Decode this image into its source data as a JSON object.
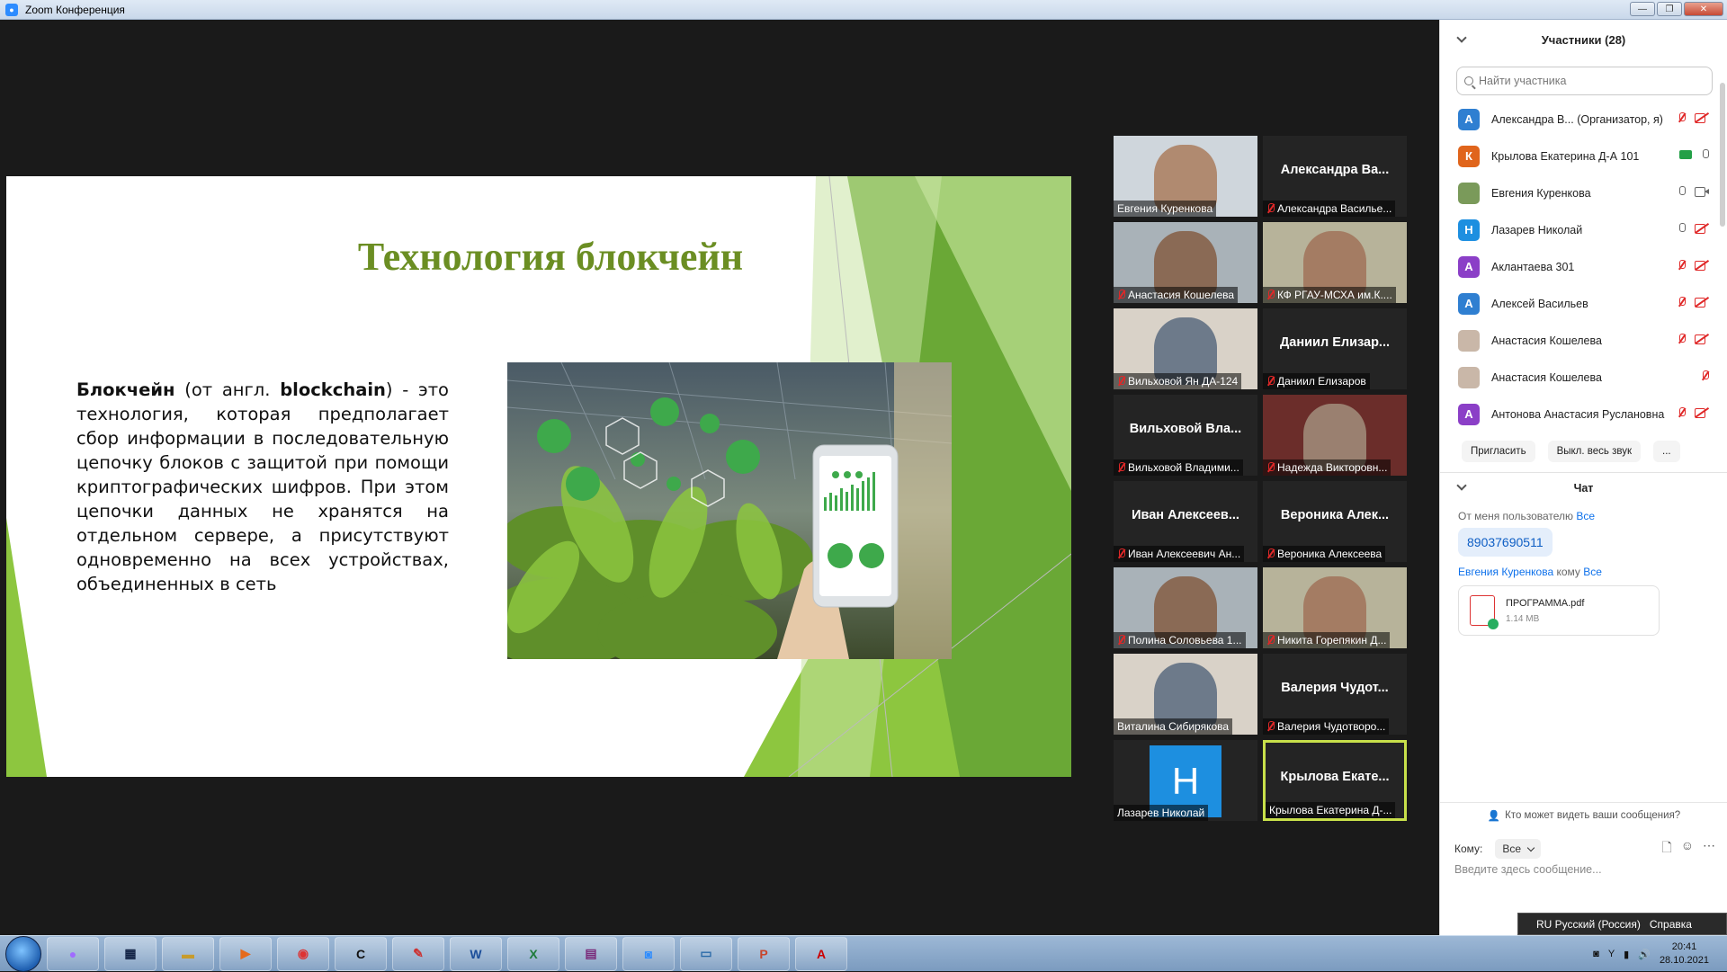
{
  "window": {
    "title": "Zoom Конференция"
  },
  "slide": {
    "title": "Технология блокчейн",
    "term": "Блокчейн",
    "intro": " (от англ. ",
    "english": "blockchain",
    "body": ") - это технология, которая предполагает сбор информации в последовательную цепочку блоков с защитой при помощи криптографических шифров. При этом цепочки данных не хранятся на отдельном сервере, а присутствуют одновременно на всех устройствах, объединенных в сеть"
  },
  "video_tiles": [
    {
      "caption": "Евгения Куренкова",
      "big_name": "",
      "muted": false,
      "video": true
    },
    {
      "caption": "Александра Василье...",
      "big_name": "Александра Ва...",
      "muted": true,
      "video": false
    },
    {
      "caption": "Анастасия Кошелева",
      "big_name": "",
      "muted": true,
      "video": true
    },
    {
      "caption": "КФ РГАУ-МСХА им.К....",
      "big_name": "",
      "muted": true,
      "video": true
    },
    {
      "caption": "Вильховой Ян ДА-124",
      "big_name": "",
      "muted": true,
      "video": true
    },
    {
      "caption": "Даниил Елизаров",
      "big_name": "Даниил Елизар...",
      "muted": true,
      "video": false
    },
    {
      "caption": "Вильховой Владими...",
      "big_name": "Вильховой Вла...",
      "muted": true,
      "video": false
    },
    {
      "caption": "Надежда Викторовн...",
      "big_name": "",
      "muted": true,
      "video": true
    },
    {
      "caption": "Иван Алексеевич Ан...",
      "big_name": "Иван Алексеев...",
      "muted": true,
      "video": false
    },
    {
      "caption": "Вероника Алексеева",
      "big_name": "Вероника Алек...",
      "muted": true,
      "video": false
    },
    {
      "caption": "Полина Соловьева 1...",
      "big_name": "",
      "muted": true,
      "video": true
    },
    {
      "caption": "Никита Горепякин Д...",
      "big_name": "",
      "muted": true,
      "video": true
    },
    {
      "caption": "Виталина Сибирякова",
      "big_name": "",
      "muted": false,
      "video": true
    },
    {
      "caption": "Валерия Чудотворо...",
      "big_name": "Валерия Чудот...",
      "muted": true,
      "video": false
    },
    {
      "caption": "Лазарев Николай",
      "big_name": "",
      "muted": false,
      "video": false,
      "avatar_letter": "H"
    },
    {
      "caption": "Крылова Екатерина Д-...",
      "big_name": "Крылова Екате...",
      "muted": false,
      "video": false,
      "active": true
    }
  ],
  "participants_panel": {
    "title": "Участники (28)",
    "search_placeholder": "Найти участника",
    "participants": [
      {
        "initial": "A",
        "color": "#2f7fd1",
        "name": "Александра В... (Организатор, я)",
        "mic": "off",
        "cam": "off"
      },
      {
        "initial": "К",
        "color": "#e0651c",
        "name": "Крылова Екатерина Д-А 101",
        "mic": "on",
        "cam": "share"
      },
      {
        "initial": "",
        "color": "#7a9a5a",
        "name": "Евгения Куренкова",
        "mic": "on",
        "cam": "on"
      },
      {
        "initial": "Н",
        "color": "#1d8fe0",
        "name": "Лазарев Николай",
        "mic": "on",
        "cam": "off"
      },
      {
        "initial": "А",
        "color": "#8b3fc7",
        "name": "Аклантаева 301",
        "mic": "off",
        "cam": "off"
      },
      {
        "initial": "А",
        "color": "#2f7fd1",
        "name": "Алексей Васильев",
        "mic": "off",
        "cam": "off"
      },
      {
        "initial": "",
        "color": "#c9b7a8",
        "name": "Анастасия Кошелева",
        "mic": "off",
        "cam": "off"
      },
      {
        "initial": "",
        "color": "#c9b7a8",
        "name": "Анастасия Кошелева",
        "mic": "off",
        "cam": "none"
      },
      {
        "initial": "А",
        "color": "#8b3fc7",
        "name": "Антонова Анастасия Руслановна",
        "mic": "off",
        "cam": "off"
      }
    ],
    "buttons": {
      "invite": "Пригласить",
      "mute_all": "Выкл. весь звук",
      "more": "..."
    }
  },
  "chat": {
    "title": "Чат",
    "msg1": {
      "prefix": "От меня пользователю ",
      "to": "Все",
      "text": "89037690511"
    },
    "msg2": {
      "from": "Евгения Куренкова",
      "mid": " кому ",
      "to": "Все",
      "file_name": "ПРОГРАММА.pdf",
      "file_size": "1.14 MB"
    },
    "who_sees": "Кто может видеть ваши сообщения?",
    "to_label": "Кому:",
    "to_value": "Все",
    "placeholder": "Введите здесь сообщение..."
  },
  "langbar": {
    "lang": "RU Русский (Россия)",
    "help": "Справка"
  },
  "taskbar": {
    "clock_time": "20:41",
    "clock_date": "28.10.2021"
  }
}
